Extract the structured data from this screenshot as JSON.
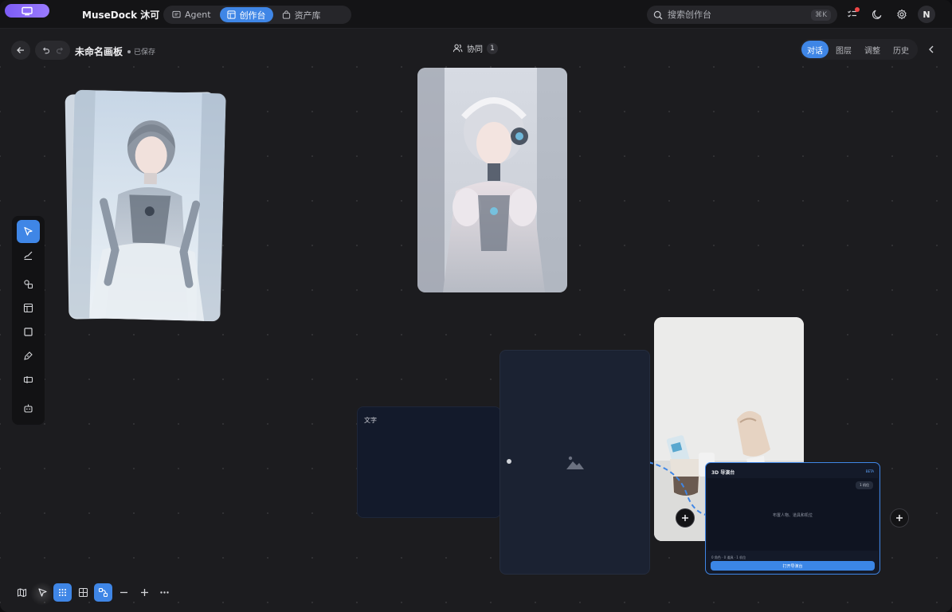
{
  "app": {
    "brand": "MuseDock 沐可"
  },
  "nav": {
    "tabs": [
      {
        "label": "Agent"
      },
      {
        "label": "创作台"
      },
      {
        "label": "资产库"
      }
    ],
    "active": "创作台"
  },
  "search": {
    "placeholder": "搜索创作台",
    "shortcut": "⌘K"
  },
  "user": {
    "avatar_initial": "N"
  },
  "document": {
    "title": "未命名画板",
    "status": "已保存"
  },
  "collab": {
    "label": "协同",
    "count": "1"
  },
  "right_panel": {
    "tabs": [
      {
        "label": "对话"
      },
      {
        "label": "图层"
      },
      {
        "label": "调整"
      },
      {
        "label": "历史"
      }
    ],
    "active": "对话"
  },
  "left_tools": [
    {
      "name": "select-tool",
      "icon": "cursor-icon",
      "active": true
    },
    {
      "name": "brush-tool",
      "icon": "brush-icon",
      "active": false
    },
    {
      "name": "shapes-tool",
      "icon": "shapes-icon",
      "active": false
    },
    {
      "name": "layout-tool",
      "icon": "layout-icon",
      "active": false
    },
    {
      "name": "frame-tool",
      "icon": "square-icon",
      "active": false
    },
    {
      "name": "pen-tool",
      "icon": "pen-icon",
      "active": false
    },
    {
      "name": "text-tool",
      "icon": "text-cursor-icon",
      "active": false
    },
    {
      "name": "bot-tool",
      "icon": "robot-icon",
      "active": false
    }
  ],
  "bottom_tools": [
    {
      "name": "map",
      "icon": "map-icon",
      "active": false
    },
    {
      "name": "pointer",
      "icon": "pointer-icon",
      "active": false
    },
    {
      "name": "dot-grid",
      "icon": "dot-grid-icon",
      "active": true
    },
    {
      "name": "grid",
      "icon": "grid-icon",
      "active": false
    },
    {
      "name": "connect",
      "icon": "connect-icon",
      "active": true
    },
    {
      "name": "zoom-out",
      "icon": "minus-icon",
      "active": false
    },
    {
      "name": "zoom-in",
      "icon": "plus-icon",
      "active": false
    },
    {
      "name": "more",
      "icon": "more-icon",
      "active": false
    }
  ],
  "nodes": {
    "text_node": {
      "label": "文字"
    },
    "stage": {
      "title": "3D 导演台",
      "badge": "BETA",
      "view_badge": "1 机位",
      "hint": "布置人物、道具和机位",
      "stats": "0 角色 · 0 道具 · 1 机位",
      "open_button": "打开导演台"
    }
  }
}
